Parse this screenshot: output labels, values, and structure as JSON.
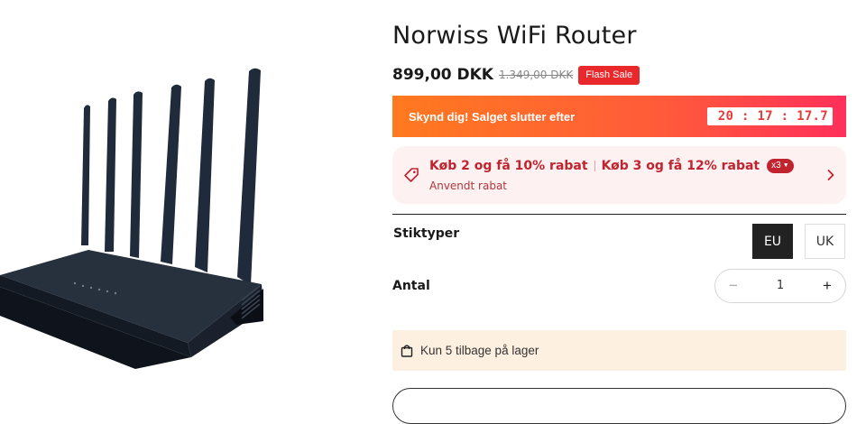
{
  "product": {
    "title": "Norwiss WiFi Router",
    "price": "899,00 DKK",
    "old_price": "1.349,00 DKK",
    "badge": "Flash Sale"
  },
  "flash": {
    "text": "Skynd dig! Salget slutter efter",
    "timer": "20 : 17 : 17.7"
  },
  "discount": {
    "offer1": "Køb 2 og få 10% rabat",
    "offer2": "Køb 3 og få 12% rabat",
    "chip": "x3",
    "applied": "Anvendt rabat"
  },
  "options": {
    "label": "Stiktyper",
    "values": [
      "EU",
      "UK"
    ],
    "selected": "EU"
  },
  "quantity": {
    "label": "Antal",
    "minus": "−",
    "value": "1",
    "plus": "+"
  },
  "stock": {
    "text": "Kun 5 tilbage på lager"
  },
  "colors": {
    "accent_red": "#e8282b",
    "flash_gradient_start": "#ff7a1f",
    "flash_gradient_end": "#ff2f5a",
    "discount_bg": "#fdf1f1",
    "stock_bg": "#fdf0e1"
  },
  "icons": [
    "router-image",
    "tag-icon",
    "chevron-right-icon",
    "chevron-down-icon",
    "bag-icon"
  ]
}
